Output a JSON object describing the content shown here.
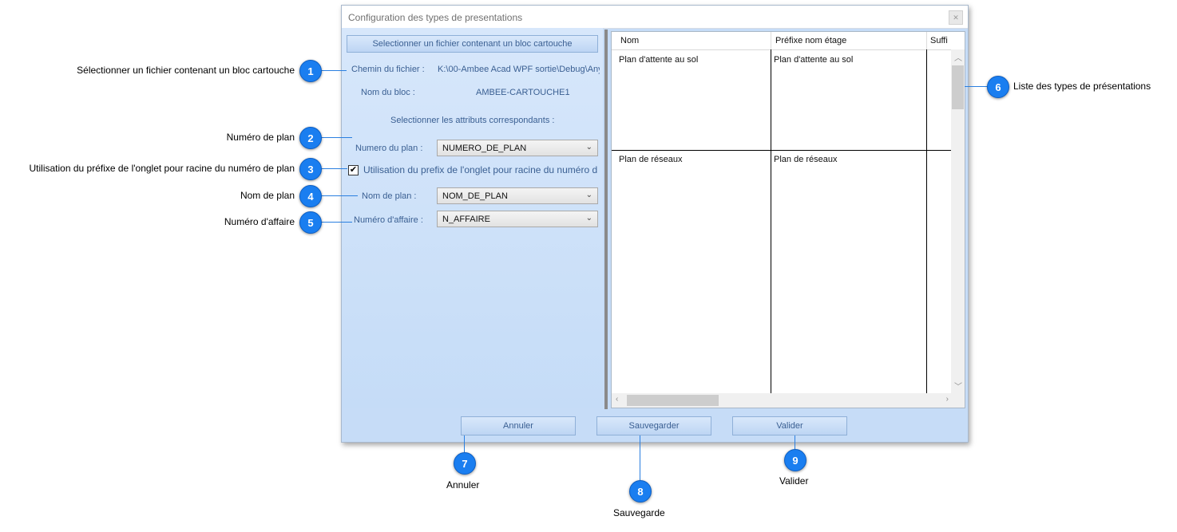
{
  "dialog": {
    "title": "Configuration des types de presentations",
    "close_icon": "close-icon",
    "select_file_button": "Selectionner un fichier contenant un bloc cartouche",
    "file_path_label": "Chemin du fichier :",
    "file_path_value": "K:\\00-Ambee Acad WPF sortie\\Debug\\Any",
    "block_name_label": "Nom du bloc :",
    "block_name_value": "AMBEE-CARTOUCHE1",
    "select_attributes_label": "Selectionner les attributs correspondants :",
    "plan_number_label": "Numero du plan :",
    "plan_number_value": "NUMERO_DE_PLAN",
    "prefix_checkbox_checked": true,
    "prefix_checkbox_label": "Utilisation du prefix de l'onglet pour racine du numéro d",
    "plan_name_label": "Nom de plan :",
    "plan_name_value": "NOM_DE_PLAN",
    "affair_number_label": "Numéro d'affaire :",
    "affair_number_value": "N_AFFAIRE",
    "grid": {
      "columns": [
        "Nom",
        "Préfixe nom étage",
        "Suffi"
      ],
      "rows": [
        [
          "Plan d'attente au sol",
          "Plan d'attente au sol",
          ""
        ],
        [
          "Plan de réseaux",
          "Plan de réseaux",
          ""
        ]
      ]
    },
    "cancel_button": "Annuler",
    "save_button": "Sauvegarder",
    "validate_button": "Valider"
  },
  "annotations": [
    {
      "number": "1",
      "text": "Sélectionner un fichier contenant un bloc cartouche"
    },
    {
      "number": "2",
      "text": "Numéro de plan"
    },
    {
      "number": "3",
      "text": "Utilisation du préfixe de l'onglet pour racine du numéro de plan"
    },
    {
      "number": "4",
      "text": "Nom de plan"
    },
    {
      "number": "5",
      "text": "Numéro d'affaire"
    },
    {
      "number": "6",
      "text": "Liste des types de présentations"
    },
    {
      "number": "7",
      "text": "Annuler"
    },
    {
      "number": "8",
      "text": "Sauvegarde"
    },
    {
      "number": "9",
      "text": "Valider"
    }
  ],
  "colors": {
    "badge": "#1a7ef0",
    "dialog_background": "#c6dcf7",
    "label_text": "#3a5f92"
  }
}
